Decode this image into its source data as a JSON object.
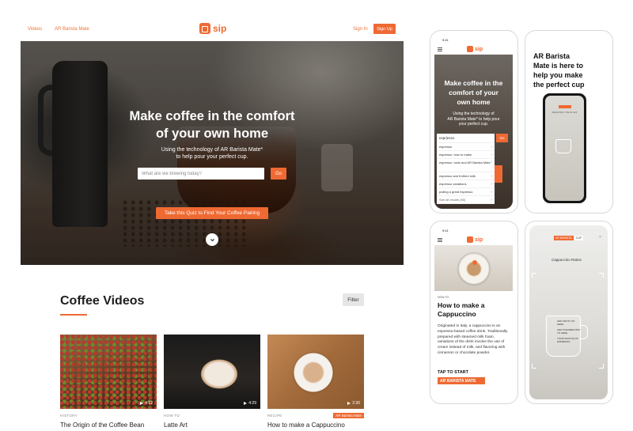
{
  "nav": {
    "videos": "Videos",
    "ar_mate": "AR Barista Mate",
    "logo": "sip",
    "sign_in": "Sign In",
    "sign_up": "Sign Up"
  },
  "hero": {
    "title_line1": "Make coffee in the comfort",
    "title_line2": "of your own home",
    "subtitle_line1": "Using the technology of AR Barista Mate*",
    "subtitle_line2": "to help pour your perfect cup.",
    "search_placeholder": "What are we brewing today?",
    "go": "Go",
    "quiz": "Take this Quiz to Find Your Coffee Pairing"
  },
  "videos": {
    "title": "Coffee Videos",
    "filter": "Filter",
    "cards": [
      {
        "category": "HISTORY",
        "title": "The Origin of the Coffee Bean",
        "duration": "4:12"
      },
      {
        "category": "HOW TO",
        "title": "Latte Art",
        "duration": "4:29"
      },
      {
        "category": "RECIPE",
        "title": "How to make a Cappuccino",
        "duration": "2:30",
        "badge": "AR Barista Mate"
      }
    ]
  },
  "phone1": {
    "time": "9:41",
    "logo": "sip",
    "title_line1": "Make coffee in the",
    "title_line2": "comfort of your",
    "title_line3": "own home",
    "sub_line1": "Using the technology of",
    "sub_line2": "AR Barista Mate* to help pour",
    "sub_line3": "your perfect cup.",
    "input_value": "espr|esso",
    "go": "Go",
    "suggestions": [
      "espresso",
      "espresso: how to make",
      "espresso: tools and AR Barista Mate",
      "espresso and frothed milk",
      "espresso variations",
      "pulling a great espresso",
      "See all results (50)"
    ]
  },
  "phone2": {
    "title_line1": "AR Barista",
    "title_line2": "Mate is here to",
    "title_line3": "help you make",
    "title_line4": "the perfect cup",
    "detect": "DETECTING TYPE OF CUP"
  },
  "phone3": {
    "time": "9:41",
    "logo": "sip",
    "label": "HOW TO",
    "title_line1": "How to make a",
    "title_line2": "Cappuccino",
    "body": "Originated in Italy, a cappuccino is an espresso-based coffee drink. Traditionally prepared with steamed milk foam, variations of the drink involve the use of cream instead of milk, and flavoring with cinnamon or chocolate powder.",
    "tap": "TAP TO START",
    "ar_button": "AR BARISTA MATE"
  },
  "phone4": {
    "tag1": "AR BARISTA",
    "tag2": "CUP",
    "close": "×",
    "ratios": "Cappuccino Ratios",
    "label1": "ADD FROTH TO HERE",
    "label2": "ADD STEAMED MILK TO HERE",
    "label3": "YOUR SHOT(S) OF ESPRESSO"
  },
  "colors": {
    "accent": "#ef6a33"
  }
}
